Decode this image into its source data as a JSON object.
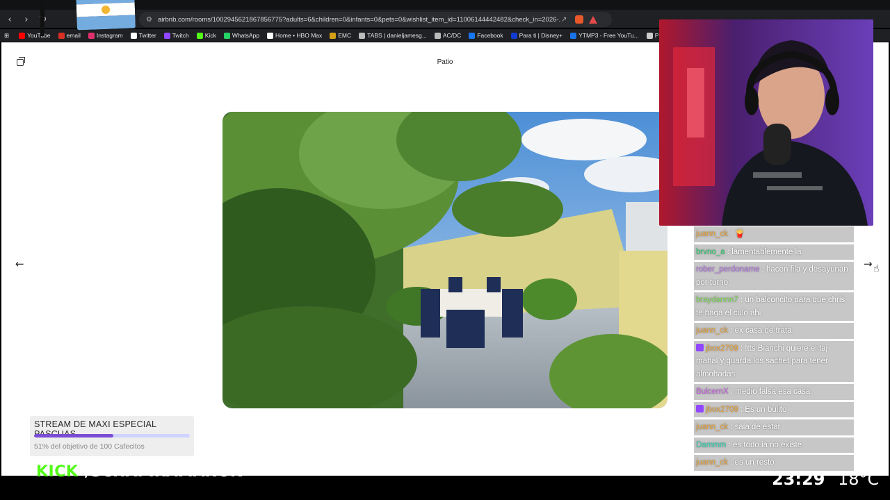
{
  "browser": {
    "url": "airbnb.com/rooms/1002945621867856775?adults=6&children=0&infants=0&pets=0&wishlist_item_id=11006144442482&check_in=2026-...",
    "bookmarks": [
      {
        "label": "YouTube",
        "color": "#ff0000"
      },
      {
        "label": "email",
        "color": "#d93025"
      },
      {
        "label": "Instagram",
        "color": "#e1306c"
      },
      {
        "label": "Twitter",
        "color": "#ffffff"
      },
      {
        "label": "Twitch",
        "color": "#9146ff"
      },
      {
        "label": "Kick",
        "color": "#53fc18"
      },
      {
        "label": "WhatsApp",
        "color": "#25d366"
      },
      {
        "label": "Home • HBO Max",
        "color": "#ffffff"
      },
      {
        "label": "EMC",
        "color": "#d4a017"
      },
      {
        "label": "TABS | danieljamesg...",
        "color": "#bbbbbb"
      },
      {
        "label": "AC/DC",
        "color": "#bbbbbb"
      },
      {
        "label": "Facebook",
        "color": "#1877f2"
      },
      {
        "label": "Para ti | Disney+",
        "color": "#113ccf"
      },
      {
        "label": "YTMP3 - Free YouTu...",
        "color": "#1a73e8"
      },
      {
        "label": "P",
        "color": "#cccccc"
      }
    ]
  },
  "page": {
    "title": "Patio"
  },
  "chat": {
    "messages": [
      {
        "user": "juann_ck",
        "text": "🍟",
        "color": "#e8a33a",
        "badge": false
      },
      {
        "user": "brvno_a",
        "text": "lamentablemente ia",
        "color": "#2ecc71",
        "badge": false
      },
      {
        "user": "rober_perdoname",
        "text": "hacen fila y desayunan por turno",
        "color": "#b370e8",
        "badge": false
      },
      {
        "user": "braydannn7",
        "text": "un balconcito para que chris te haga el culo ahi",
        "color": "#7ed957",
        "badge": false
      },
      {
        "user": "juann_ck",
        "text": "ex casa de trata",
        "color": "#e8a33a",
        "badge": false
      },
      {
        "user": "jbox2709",
        "text": "!tts Bianchi quiere el taj mahal y guarda los sachet para tener almohadas",
        "color": "#e8a33a",
        "badge": true
      },
      {
        "user": "BulcernX",
        "text": "medio falsa esa casa",
        "color": "#c563e0",
        "badge": false
      },
      {
        "user": "jbox2709",
        "text": "Es un bulito",
        "color": "#e8a33a",
        "badge": true
      },
      {
        "user": "juann_ck",
        "text": "sala de estar",
        "color": "#e8a33a",
        "badge": false
      },
      {
        "user": "Dammm",
        "text": "es todo ia no existe",
        "color": "#35d0b0",
        "badge": false
      },
      {
        "user": "juann_ck",
        "text": "es un resto",
        "color": "#e8a33a",
        "badge": false
      }
    ]
  },
  "goal": {
    "title": "STREAM DE MAXI ESPECIAL PASCUAS",
    "subtitle": "51% del objetivo de 100 Cafecitos",
    "progress": 0.51
  },
  "overlay": {
    "kick_label": "KICK",
    "handle": "/SCHAPIRAMANUK",
    "clock": "23:29",
    "temp": "18°C"
  }
}
